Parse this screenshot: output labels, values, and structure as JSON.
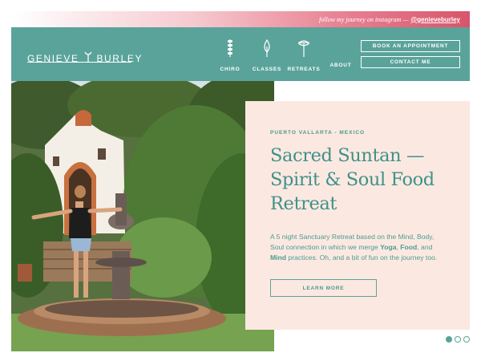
{
  "topbar": {
    "follow_text": "follow my journey on instagram —",
    "handle": "@genieveburley"
  },
  "logo": {
    "part1": "GENIEVE",
    "part2": "BURLEY"
  },
  "nav": [
    {
      "label": "CHIRO",
      "icon": "spine-icon"
    },
    {
      "label": "CLASSES",
      "icon": "flame-icon"
    },
    {
      "label": "RETREATS",
      "icon": "palm-tree-icon"
    },
    {
      "label": "ABOUT",
      "icon": ""
    }
  ],
  "header_buttons": {
    "book": "BOOK AN APPOINTMENT",
    "contact": "CONTACT ME"
  },
  "hero": {
    "eyebrow": "PUERTO VALLARTA - MEXICO",
    "title_line1": "Sacred Suntan —",
    "title_line2": "Spirit & Soul Food",
    "title_line3": "Retreat",
    "desc_part1": "A 5 night Sanctuary Retreat based on the Mind, Body, Soul connection in which we merge ",
    "desc_yoga": "Yoga",
    "desc_part2": ", ",
    "desc_food": "Food",
    "desc_part3": ", and ",
    "desc_mind": "Mind",
    "desc_part4": " practices. Oh, and a bit of fun on the journey too.",
    "cta": "LEARN MORE"
  },
  "carousel": {
    "total": 3,
    "active": 1
  },
  "colors": {
    "teal": "#5aa39a",
    "card_bg": "#fbe9e1",
    "pink": "#d9546b"
  }
}
